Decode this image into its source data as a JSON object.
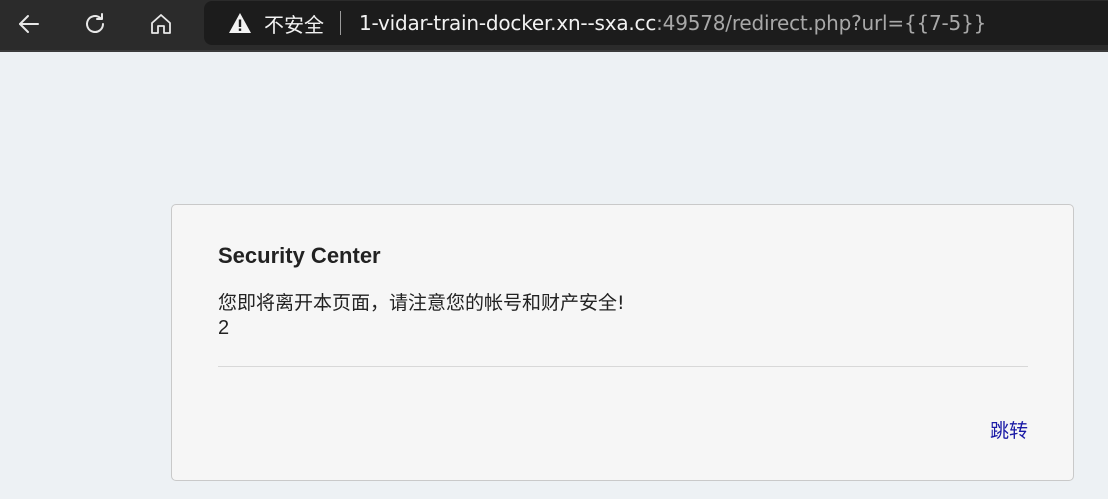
{
  "browser": {
    "insecure_label": "不安全",
    "url_host": "1-vidar-train-docker.xn--sxa.cc",
    "url_rest": ":49578/redirect.php?url={{7-5}}",
    "icons": [
      "back-arrow-icon",
      "reload-icon",
      "home-icon",
      "warning-icon"
    ]
  },
  "card": {
    "title": "Security Center",
    "message": "您即将离开本页面，请注意您的帐号和财产安全!",
    "value": "2",
    "link_label": "跳转",
    "link_color": "#1a1aa6"
  }
}
